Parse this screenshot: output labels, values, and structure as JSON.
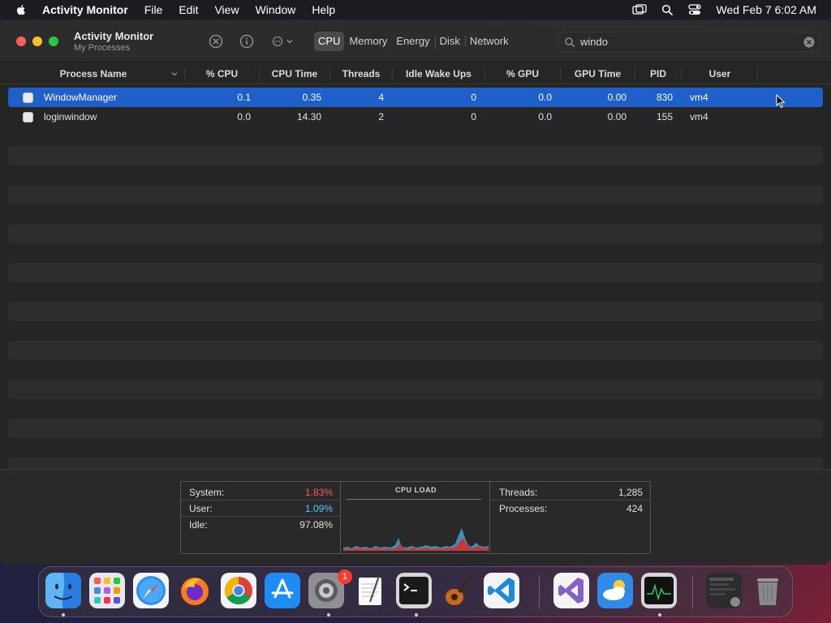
{
  "menubar": {
    "app_name": "Activity Monitor",
    "items": [
      "File",
      "Edit",
      "View",
      "Window",
      "Help"
    ],
    "clock": "Wed Feb 7  6:02 AM"
  },
  "window": {
    "title": "Activity Monitor",
    "subtitle": "My Processes"
  },
  "tabs": [
    {
      "label": "CPU",
      "active": true
    },
    {
      "label": "Memory",
      "active": false
    },
    {
      "label": "Energy",
      "active": false
    },
    {
      "label": "Disk",
      "active": false
    },
    {
      "label": "Network",
      "active": false
    }
  ],
  "search": {
    "value": "windo",
    "placeholder": "Search"
  },
  "columns": [
    "Process Name",
    "% CPU",
    "CPU Time",
    "Threads",
    "Idle Wake Ups",
    "% GPU",
    "GPU Time",
    "PID",
    "User"
  ],
  "processes": [
    {
      "name": "WindowManager",
      "cpu": "0.1",
      "cpu_time": "0.35",
      "threads": "4",
      "idle_wake_ups": "0",
      "gpu": "0.0",
      "gpu_time": "0.00",
      "pid": "830",
      "user": "vm4",
      "selected": true
    },
    {
      "name": "loginwindow",
      "cpu": "0.0",
      "cpu_time": "14.30",
      "threads": "2",
      "idle_wake_ups": "0",
      "gpu": "0.0",
      "gpu_time": "0.00",
      "pid": "155",
      "user": "vm4",
      "selected": false
    }
  ],
  "cpu_stats": {
    "system_label": "System:",
    "system_value": "1.83%",
    "user_label": "User:",
    "user_value": "1.09%",
    "idle_label": "Idle:",
    "idle_value": "97.08%",
    "colors": {
      "system": "#ff5a4f",
      "user": "#5ac8fa"
    }
  },
  "cpu_load": {
    "title": "CPU LOAD"
  },
  "proc_stats": {
    "threads_label": "Threads:",
    "threads_value": "1,285",
    "processes_label": "Processes:",
    "processes_value": "424"
  },
  "dock": {
    "apps": [
      "finder-icon",
      "launchpad-icon",
      "safari-icon",
      "firefox-icon",
      "chrome-icon",
      "app-store-icon",
      "system-settings-icon",
      "textedit-icon",
      "terminal-icon",
      "garageband-icon",
      "vscode-icon",
      "visual-studio-icon",
      "weather-icon",
      "activity-monitor-icon",
      "downloads-stack-icon",
      "trash-icon"
    ],
    "settings_badge": "1"
  }
}
